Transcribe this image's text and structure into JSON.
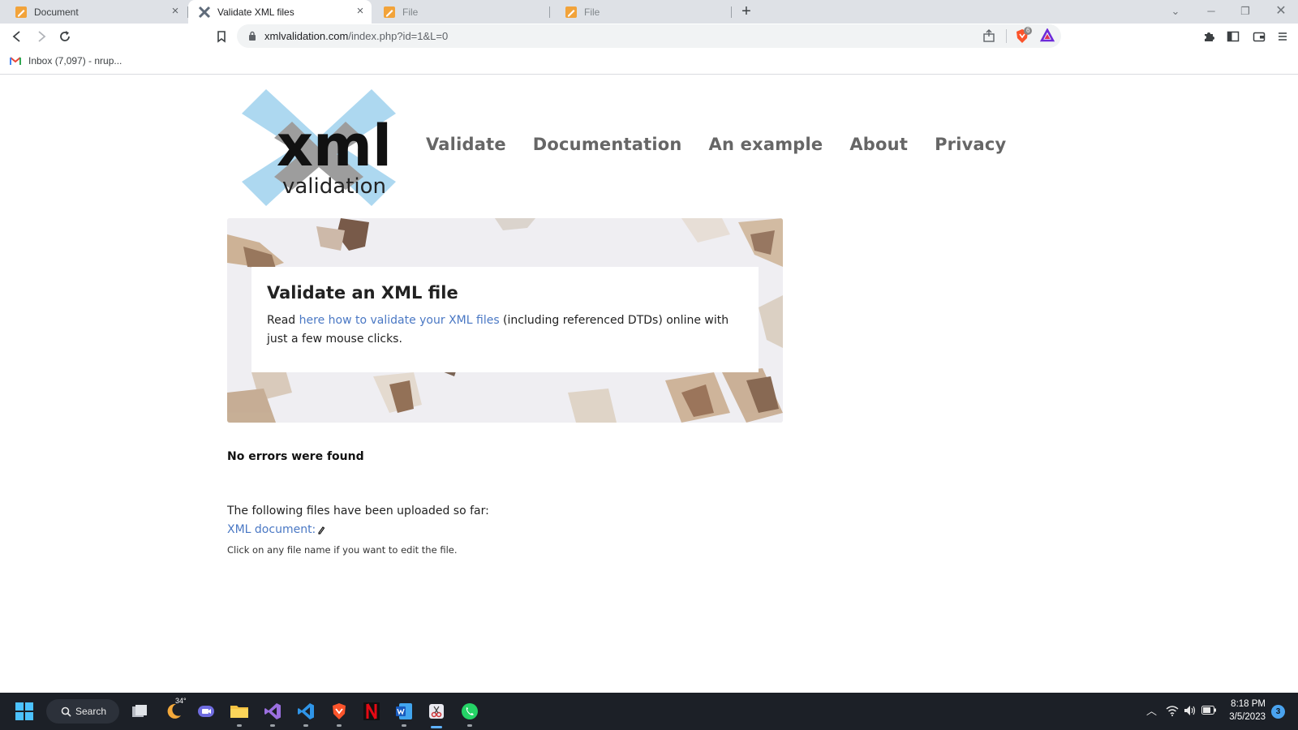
{
  "browser": {
    "tabs": [
      {
        "label": "Document",
        "favicon": "pencil-doc-icon",
        "active": false
      },
      {
        "label": "Validate XML files",
        "favicon": "xml-x-icon",
        "active": true
      },
      {
        "label": "File",
        "favicon": "pencil-doc-icon",
        "active": false
      },
      {
        "label": "File",
        "favicon": "pencil-doc-icon",
        "active": false
      }
    ],
    "url_domain": "xmlvalidation.com",
    "url_path": "/index.php?id=1&L=0",
    "brave_shield_count": "6",
    "bookmarks": [
      {
        "label": "Inbox (7,097) - nrup...",
        "icon": "gmail-icon"
      }
    ]
  },
  "site": {
    "logo_text": "xml",
    "logo_subtext": "validation",
    "nav": [
      "Validate",
      "Documentation",
      "An example",
      "About",
      "Privacy"
    ],
    "hero": {
      "title": "Validate an XML file",
      "text_before": "Read ",
      "link_text": "here how to validate your XML files",
      "text_after": " (including referenced DTDs) online with just a few mouse clicks."
    },
    "status": "No errors were found",
    "uploaded_label": "The following files have been uploaded so far:",
    "file_link": "XML document:",
    "hint": "Click on any file name if you want to edit the file."
  },
  "taskbar": {
    "search_label": "Search",
    "weather_temp": "34°",
    "time": "8:18 PM",
    "date": "3/5/2023",
    "notification_count": "3"
  },
  "colors": {
    "link": "#4a78c4",
    "nav": "#666666",
    "logo_x": "#add8f0",
    "taskbar": "#1c2027"
  }
}
